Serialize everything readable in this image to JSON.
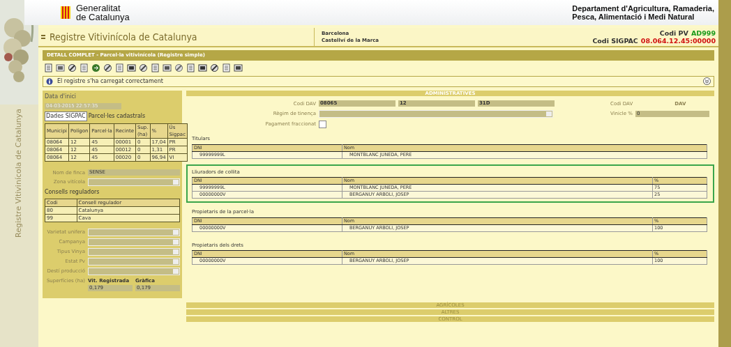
{
  "header": {
    "logo_lines": [
      "Generalitat",
      "de Catalunya"
    ],
    "department_lines": [
      "Departament d'Agricultura, Ramaderia,",
      "Pesca, Alimentació i Medi Natural"
    ]
  },
  "side_text": "Registre Vitivinícola de Catalunya",
  "app_title": "Registre Vitivinícola de Catalunya",
  "location": [
    "Barcelona",
    "Castellví de la Marca"
  ],
  "codes": [
    {
      "label": "Codi PV",
      "value": "AD999",
      "color": "#1a9a1a"
    },
    {
      "label": "Codi SIGPAC",
      "value": "08.064.12.45:00000",
      "color": "#d01010"
    }
  ],
  "breadcrumb": "DETALL COMPLET - Parcel·la vitivinícola (Registre simple)",
  "message": "El registre s'ha carregat correctament",
  "left": {
    "date_label": "Data d'inici",
    "date_value": "04-03-2015 22:57:35",
    "tabs": [
      {
        "label": "Dades SIGPAC",
        "selected": true
      },
      {
        "label": "Parcel·les cadastrals",
        "selected": false
      }
    ],
    "sigpac": {
      "columns": [
        "Municipi",
        "Polígon",
        "Parcel·la",
        "Recinte",
        "Sup. (ha)",
        "%",
        "Ús Sigpac"
      ],
      "rows": [
        [
          "08064",
          "12",
          "45",
          "00001",
          "0",
          "17,04",
          "PR"
        ],
        [
          "08064",
          "12",
          "45",
          "00012",
          "0",
          "1,31",
          "PR"
        ],
        [
          "08064",
          "12",
          "45",
          "00020",
          "0",
          "96,94",
          "VI"
        ]
      ]
    },
    "nom_finca": {
      "label": "Nom de finca",
      "value": "SENSE"
    },
    "zona": {
      "label": "Zona vitícola"
    },
    "consells": {
      "title": "Consells reguladors",
      "columns": [
        "Codi",
        "Consell regulador"
      ],
      "rows": [
        [
          "80",
          "Catalunya"
        ],
        [
          "99",
          "Cava"
        ]
      ]
    },
    "selects": [
      "Varietat unifera",
      "Campanya",
      "Tipus Vinya",
      "Estat Pv",
      "Destí producció"
    ],
    "superficies": {
      "label": "Superfícies (ha)",
      "columns": [
        "Vit. Registrada",
        "Gràfica"
      ],
      "values": [
        "0,179",
        "0,179"
      ]
    }
  },
  "right": {
    "section": "ADMINISTRATIVES",
    "codi_dav": {
      "label": "Codi DAV",
      "values": [
        "08065",
        "12",
        "31D"
      ]
    },
    "regim": {
      "label": "Règim de tinença"
    },
    "pagament": {
      "label": "Pagament fraccionat",
      "checked": false
    },
    "codi_dav_2": {
      "label": "Codi DAV",
      "value": "DAV"
    },
    "vinicle": {
      "label": "Vinicle %",
      "value": "0"
    },
    "tables": [
      {
        "title": "Titulars",
        "highlighted": false,
        "columns": [
          "DNI",
          "Nom"
        ],
        "rows": [
          [
            "99999999L",
            "MONTBLANC JUNEDA, PERE"
          ]
        ]
      },
      {
        "title": "Lliuradors de collita",
        "highlighted": true,
        "columns": [
          "DNI",
          "Nom",
          "%"
        ],
        "rows": [
          [
            "99999999L",
            "MONTBLANC JUNEDA, PERE",
            "75"
          ],
          [
            "00000000V",
            "BERGANUY ARBOLI, JOSEP",
            "25"
          ]
        ]
      },
      {
        "title": "Propietaris de la parcel·la",
        "highlighted": false,
        "columns": [
          "DNI",
          "Nom",
          "%"
        ],
        "rows": [
          [
            "00000000V",
            "BERGANUY ARBOLI, JOSEP",
            "100"
          ]
        ]
      },
      {
        "title": "Propietaris dels drets",
        "highlighted": false,
        "columns": [
          "DNI",
          "Nom",
          "%"
        ],
        "rows": [
          [
            "00000000V",
            "BERGANUY ARBOLI, JOSEP",
            "100"
          ]
        ]
      }
    ],
    "sections": [
      "AGRÍCOLES",
      "ALTRES",
      "CONTROL"
    ]
  }
}
